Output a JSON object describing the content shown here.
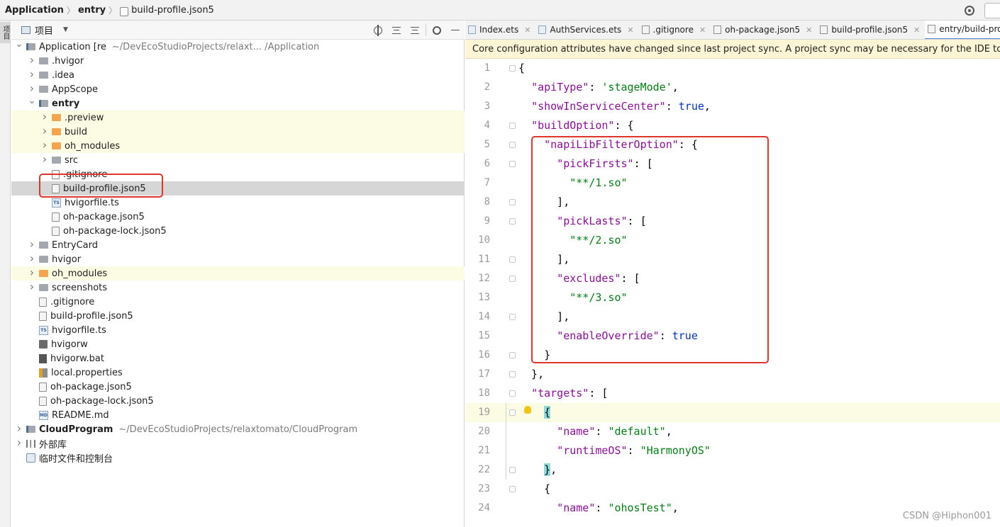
{
  "breadcrumb": {
    "project": "Application",
    "module": "entry",
    "file": "build-profile.json5"
  },
  "left_strip": {
    "tab_label": "项目"
  },
  "project_panel": {
    "view_label": "项目",
    "tree": [
      {
        "name": "Application",
        "suffix": " [re",
        "path": "~/DevEcoStudioProjects/relaxt...    /Application",
        "bold": false,
        "kind": "module",
        "arrow": "down"
      },
      {
        "name": ".hvigor",
        "kind": "folder",
        "arrow": "right"
      },
      {
        "name": ".idea",
        "kind": "folder",
        "arrow": "right"
      },
      {
        "name": "AppScope",
        "kind": "folder",
        "arrow": "right"
      },
      {
        "name": "entry",
        "kind": "module",
        "arrow": "down",
        "bold": true
      },
      {
        "name": ".preview",
        "kind": "folder-orange",
        "arrow": "right"
      },
      {
        "name": "build",
        "kind": "folder-orange",
        "arrow": "right"
      },
      {
        "name": "oh_modules",
        "kind": "folder-orange",
        "arrow": "right"
      },
      {
        "name": "src",
        "kind": "folder",
        "arrow": "right"
      },
      {
        "name": ".gitignore",
        "kind": "file"
      },
      {
        "name": "build-profile.json5",
        "kind": "file"
      },
      {
        "name": "hvigorfile.ts",
        "kind": "ts"
      },
      {
        "name": "oh-package.json5",
        "kind": "file"
      },
      {
        "name": "oh-package-lock.json5",
        "kind": "file"
      },
      {
        "name": "EntryCard",
        "kind": "folder",
        "arrow": "right"
      },
      {
        "name": "hvigor",
        "kind": "folder",
        "arrow": "right"
      },
      {
        "name": "oh_modules",
        "kind": "folder-orange",
        "arrow": "right"
      },
      {
        "name": "screenshots",
        "kind": "folder",
        "arrow": "right"
      },
      {
        "name": ".gitignore",
        "kind": "file"
      },
      {
        "name": "build-profile.json5",
        "kind": "file"
      },
      {
        "name": "hvigorfile.ts",
        "kind": "ts"
      },
      {
        "name": "hvigorw",
        "kind": "exe"
      },
      {
        "name": "hvigorw.bat",
        "kind": "bat"
      },
      {
        "name": "local.properties",
        "kind": "prop"
      },
      {
        "name": "oh-package.json5",
        "kind": "file"
      },
      {
        "name": "oh-package-lock.json5",
        "kind": "file"
      },
      {
        "name": "README.md",
        "kind": "md"
      },
      {
        "name": "CloudProgram",
        "path": "~/DevEcoStudioProjects/relaxtomato/CloudProgram",
        "kind": "module",
        "arrow": "right",
        "bold": true
      },
      {
        "name": "外部库",
        "kind": "lib",
        "arrow": "right"
      },
      {
        "name": "临时文件和控制台",
        "kind": "scratch"
      }
    ]
  },
  "editor": {
    "tabs": [
      {
        "label": "Index.ets",
        "icon": "ts"
      },
      {
        "label": "AuthServices.ets",
        "icon": "ts"
      },
      {
        "label": ".gitignore",
        "icon": "file"
      },
      {
        "label": "oh-package.json5",
        "icon": "file"
      },
      {
        "label": "build-profile.json5",
        "icon": "file"
      },
      {
        "label": "entry/build-profile",
        "icon": "file",
        "active": true
      }
    ],
    "notice": "Core configuration attributes have changed since last project sync. A project sync may be necessary for the IDE to wor",
    "line_numbers": [
      "1",
      "2",
      "3",
      "4",
      "5",
      "6",
      "7",
      "8",
      "9",
      "10",
      "11",
      "12",
      "13",
      "14",
      "15",
      "16",
      "17",
      "18",
      "19",
      "20",
      "21",
      "22",
      "23",
      "24"
    ],
    "lines": [
      "{",
      "  \"apiType\": 'stageMode',",
      "  \"showInServiceCenter\": true,",
      "  \"buildOption\": {",
      "    \"napiLibFilterOption\": {",
      "      \"pickFirsts\": [",
      "        \"**/1.so\"",
      "      ],",
      "      \"pickLasts\": [",
      "        \"**/2.so\"",
      "      ],",
      "      \"excludes\": [",
      "        \"**/3.so\"",
      "      ],",
      "      \"enableOverride\": true",
      "    }",
      "  },",
      "  \"targets\": [",
      "    {",
      "      \"name\": \"default\",",
      "      \"runtimeOS\": \"HarmonyOS\"",
      "    },",
      "    {",
      "      \"name\": \"ohosTest\","
    ]
  },
  "watermark": "CSDN @Hiphon001",
  "colors": {
    "key": "#871094",
    "string": "#067d17",
    "keyword": "#0033b3",
    "highlight": "#e0352b"
  }
}
